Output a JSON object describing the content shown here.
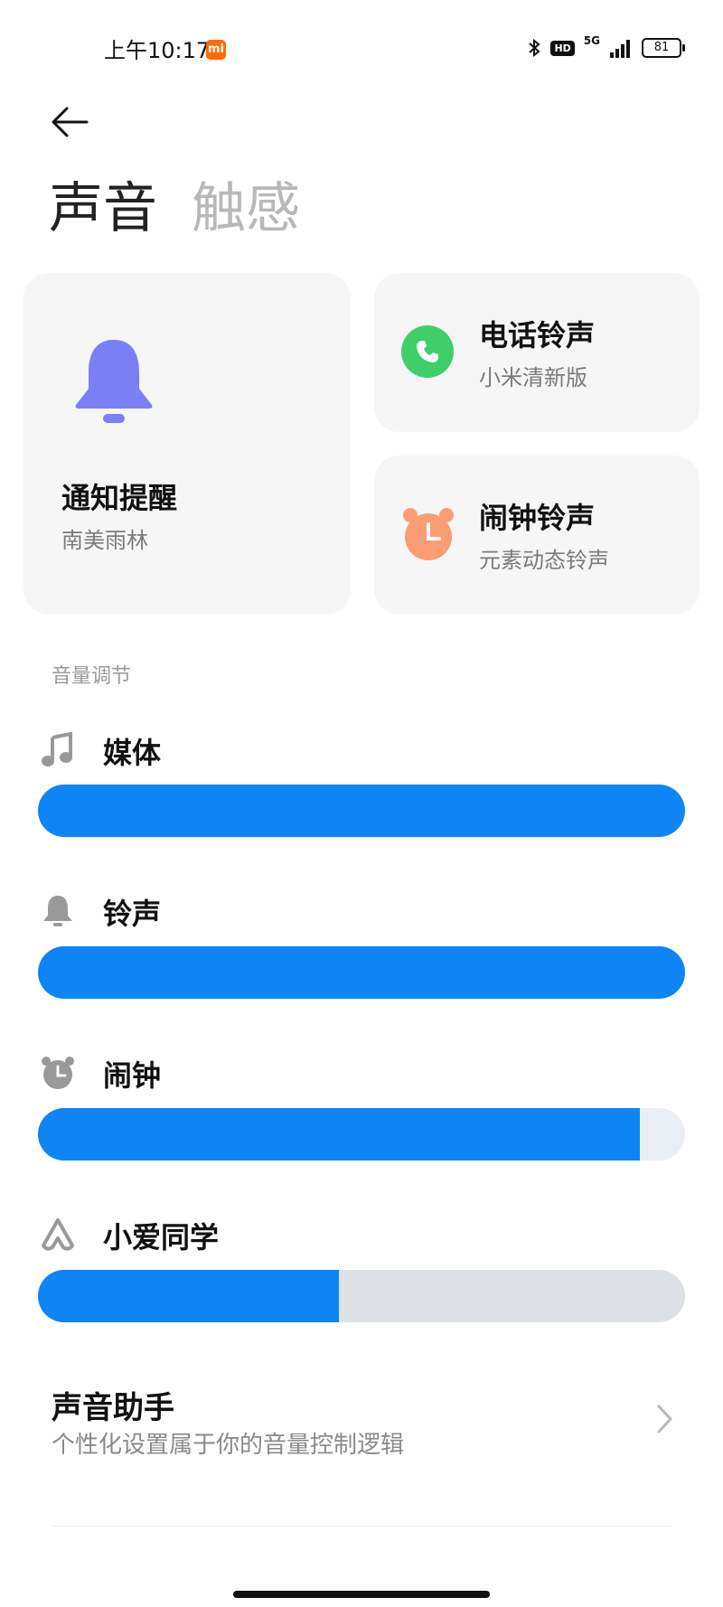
{
  "status_bar": {
    "time": "上午10:17",
    "mi_badge": "mi",
    "hd": "HD",
    "network": "5G",
    "battery": "81"
  },
  "tabs": {
    "sound": "声音",
    "haptic": "触感"
  },
  "cards": {
    "notification": {
      "title": "通知提醒",
      "subtitle": "南美雨林"
    },
    "phone": {
      "title": "电话铃声",
      "subtitle": "小米清新版"
    },
    "alarm": {
      "title": "闹钟铃声",
      "subtitle": "元素动态铃声"
    }
  },
  "volume": {
    "section_label": "音量调节",
    "sliders": [
      {
        "label": "媒体",
        "icon": "music-note-icon",
        "level": 1.0
      },
      {
        "label": "铃声",
        "icon": "bell-icon",
        "level": 1.0
      },
      {
        "label": "闹钟",
        "icon": "alarm-clock-icon",
        "level": 0.93
      },
      {
        "label": "小爱同学",
        "icon": "xiaoai-icon",
        "level": 0.465
      }
    ]
  },
  "sound_assistant": {
    "title": "声音助手",
    "subtitle": "个性化设置属于你的音量控制逻辑"
  },
  "colors": {
    "accent": "#0f84f5",
    "bell_icon": "#7a7ff5",
    "phone_icon": "#3fce6a",
    "alarm_icon": "#fb9d74"
  }
}
